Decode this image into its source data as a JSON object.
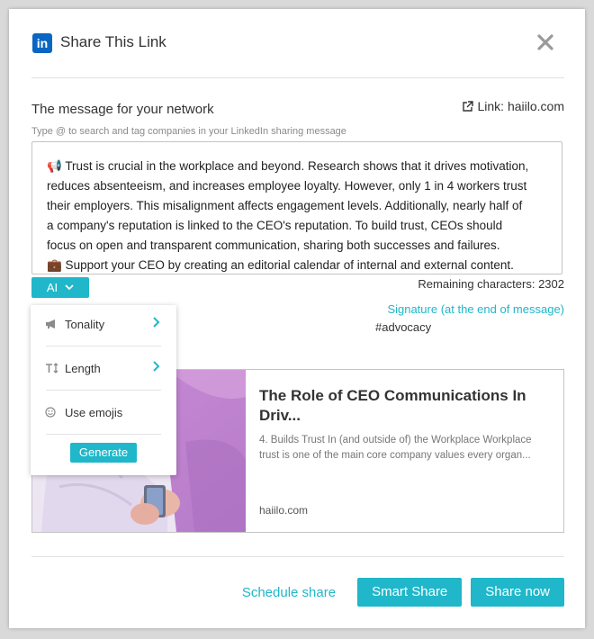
{
  "modal": {
    "title": "Share This Link",
    "logo_text": "in"
  },
  "message": {
    "label": "The message for your network",
    "link_prefix": "Link: haiilo.com",
    "hint": "Type @ to search and tag companies in your LinkedIn sharing message",
    "lines": [
      "📢 Trust is crucial in the workplace and beyond. Research shows that it drives motivation,",
      "reduces absenteeism, and increases employee loyalty. However, only 1 in 4 workers trust",
      "their employers. This misalignment affects engagement levels. Additionally, nearly half of",
      "a company's reputation is linked to the CEO's reputation. To build trust, CEOs should",
      "focus on open and transparent communication, sharing both successes and failures.",
      "💼 Support your CEO by creating an editorial calendar of internal and external content."
    ],
    "ai_label": "AI",
    "remaining": "Remaining characters: 2302",
    "signature": "Signature (at the end of message)",
    "hashtag": "#advocacy"
  },
  "ai_menu": {
    "items": [
      {
        "label": "Tonality",
        "icon": "megaphone-icon"
      },
      {
        "label": "Length",
        "icon": "text-height-icon"
      },
      {
        "label": "Use emojis",
        "icon": "smiley-icon"
      }
    ],
    "generate_label": "Generate"
  },
  "preview": {
    "title": "The Role of CEO Communications In Driv...",
    "description": "4. Builds Trust In (and outside of) the Workplace Workplace trust is one of the main core company values every organ...",
    "domain": "haiilo.com"
  },
  "footer": {
    "schedule_label": "Schedule share",
    "smart_label": "Smart Share",
    "share_label": "Share now"
  },
  "colors": {
    "accent": "#1fb7c9",
    "linkedin": "#0a66c2"
  }
}
